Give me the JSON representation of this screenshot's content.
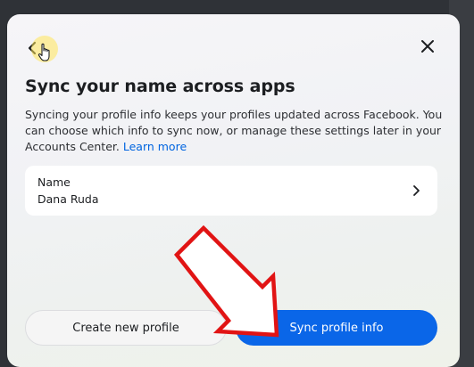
{
  "dialog": {
    "title": "Sync your name across apps",
    "description_text": "Syncing your profile info keeps your profiles updated across Facebook. You can choose which info to sync now, or manage these settings later in your Accounts Center.",
    "learn_more_link": "Learn more"
  },
  "name_card": {
    "label": "Name",
    "value": "Dana Ruda"
  },
  "buttons": {
    "secondary_label": "Create new profile",
    "primary_label": "Sync profile info"
  },
  "icons": {
    "back": "chevron-left-icon",
    "close": "close-icon",
    "name_card_chevron": "chevron-right-icon",
    "cursor": "hand-pointer-icon",
    "annotation": "red-arrow-annotation"
  },
  "colors": {
    "primary_button": "#0a66e8",
    "link": "#0064e0",
    "annotation_arrow": "#e11414",
    "cursor_highlight": "#ffe65a"
  }
}
